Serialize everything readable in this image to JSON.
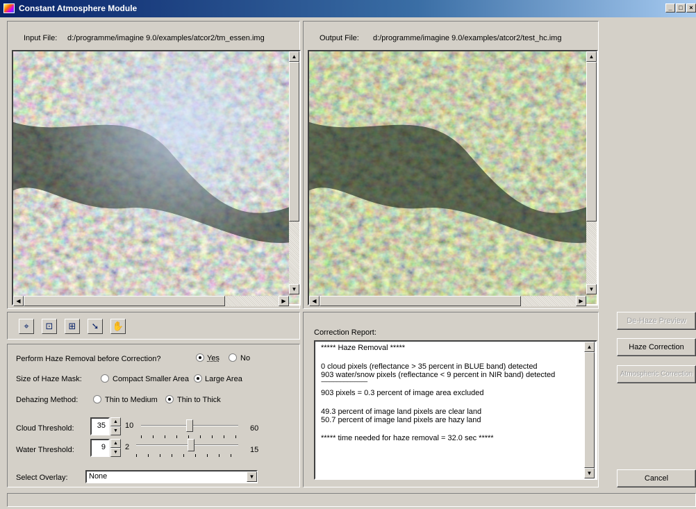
{
  "window": {
    "title": "Constant Atmosphere Module",
    "controls": [
      "_",
      "□",
      "×"
    ]
  },
  "input": {
    "label": "Input File:",
    "path": "d:/programme/imagine 9.0/examples/atcor2/tm_essen.img"
  },
  "output": {
    "label": "Output File:",
    "path": "d:/programme/imagine 9.0/examples/atcor2/test_hc.img"
  },
  "toolbar": {
    "icons": [
      "zoom-in-icon",
      "zoom-fit-icon",
      "zoom-out-icon",
      "arrow-pointer-icon",
      "hand-pan-icon"
    ]
  },
  "settings": {
    "haze_removal": {
      "label": "Perform Haze Removal before Correction?",
      "options": [
        "Yes",
        "No"
      ],
      "selected": "Yes"
    },
    "haze_mask": {
      "label": "Size of Haze Mask:",
      "options": [
        "Compact Smaller Area",
        "Large Area"
      ],
      "selected": "Large Area"
    },
    "dehazing": {
      "label": "Dehazing Method:",
      "options": [
        "Thin to Medium",
        "Thin to Thick"
      ],
      "selected": "Thin to Thick"
    },
    "cloud_threshold": {
      "label": "Cloud Threshold:",
      "value": "35",
      "min": "10",
      "max": "60",
      "level": 0.5
    },
    "water_threshold": {
      "label": "Water Threshold:",
      "value": "9",
      "min": "2",
      "max": "15",
      "level": 0.54
    },
    "overlay": {
      "label": "Select Overlay:",
      "value": "None"
    }
  },
  "report": {
    "label": "Correction Report:",
    "lines": [
      "***** Haze Removal *****",
      "0 cloud pixels (reflectance > 35 percent in BLUE band) detected",
      "903 water/snow pixels (reflectance <  9 percent in NIR band) detected",
      "----------------------------------------",
      "903 pixels = 0.3 percent of image area excluded",
      "49.3 percent of image land pixels are clear land",
      "50.7 percent of image land pixels are hazy land",
      "***** time needed for haze removal = 32.0 sec *****"
    ]
  },
  "buttons": {
    "dehaze_preview": "De-Haze Preview",
    "haze_correction": "Haze Correction",
    "atmospheric_correction": "Atmospheric Correction",
    "cancel": "Cancel"
  }
}
